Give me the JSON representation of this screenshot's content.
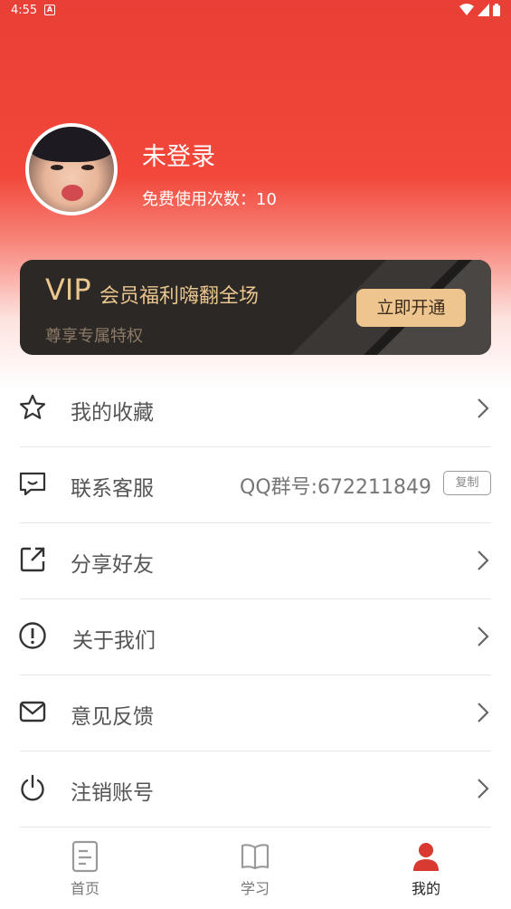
{
  "status_bar": {
    "time": "4:55",
    "notif_icon": "A"
  },
  "profile": {
    "name": "未登录",
    "free_uses": "免费使用次数：10"
  },
  "vip": {
    "badge": "VIP",
    "title": "会员福利嗨翻全场",
    "subtitle": "尊享专属特权",
    "button": "立即开通",
    "colors": {
      "gold": "#eac58d",
      "card": "#2b2826"
    }
  },
  "menu": {
    "items": [
      {
        "label": "我的收藏",
        "icon": "star-icon"
      },
      {
        "label": "联系客服",
        "icon": "chat-icon",
        "qq": "QQ群号:672211849",
        "copy": "复制"
      },
      {
        "label": "分享好友",
        "icon": "share-icon"
      },
      {
        "label": "关于我们",
        "icon": "info-icon"
      },
      {
        "label": "意见反馈",
        "icon": "mail-icon"
      },
      {
        "label": "注销账号",
        "icon": "power-icon"
      }
    ]
  },
  "tabs": [
    {
      "label": "首页",
      "icon": "document-icon"
    },
    {
      "label": "学习",
      "icon": "book-icon"
    },
    {
      "label": "我的",
      "icon": "person-icon",
      "active": true
    }
  ],
  "theme": {
    "primary": "#e8403a",
    "active_tab": "#d83a32"
  }
}
